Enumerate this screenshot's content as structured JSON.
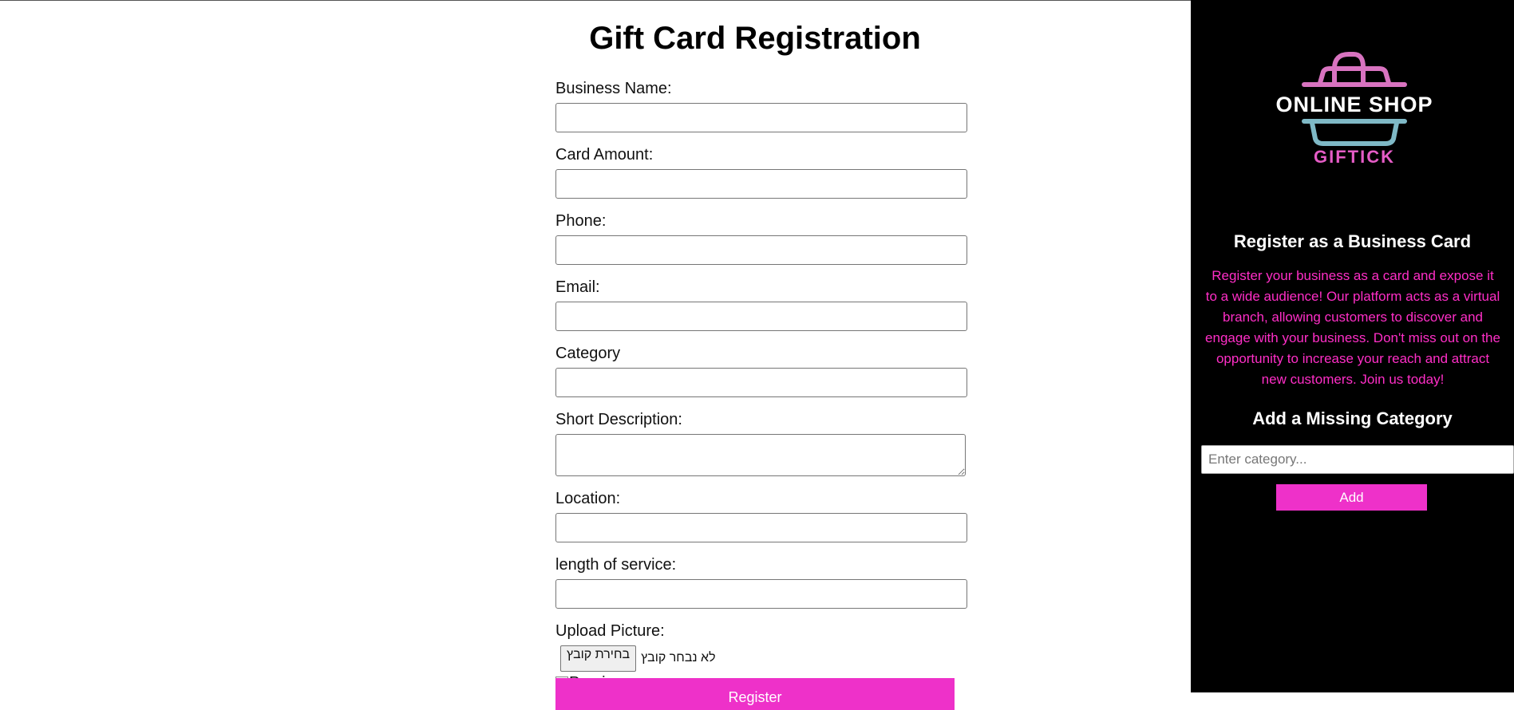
{
  "page": {
    "title": "Gift Card Registration"
  },
  "form": {
    "fields": [
      {
        "label": "Business Name:",
        "value": ""
      },
      {
        "label": "Card Amount:",
        "value": ""
      },
      {
        "label": "Phone:",
        "value": ""
      },
      {
        "label": "Email:",
        "value": ""
      },
      {
        "label": "Category",
        "value": ""
      },
      {
        "label": "Short Description:",
        "value": ""
      },
      {
        "label": "Location:",
        "value": ""
      },
      {
        "label": "length of service:",
        "value": ""
      }
    ],
    "upload": {
      "label": "Upload Picture:",
      "button_label": "בחירת קובץ",
      "status": "לא נבחר קובץ",
      "preview_alt": "Preview"
    },
    "submit_label": "Register"
  },
  "sidebar": {
    "logo": {
      "text": "ONLINE SHOP",
      "subtext": "GIFTICK",
      "colors": {
        "bag_handle": "#d873c0",
        "bag_base": "#7fb9c6"
      }
    },
    "register": {
      "heading": "Register as a Business Card",
      "text": "Register your business as a card and expose it to a wide audience! Our platform acts as a virtual branch, allowing customers to discover and engage with your business. Don't miss out on the opportunity to increase your reach and attract new customers. Join us today!"
    },
    "category": {
      "heading": "Add a Missing Category",
      "placeholder": "Enter category...",
      "button_label": "Add"
    }
  },
  "colors": {
    "accent": "#ee31c9",
    "sidebar_bg": "#000000",
    "sidebar_text": "#ff2ec7"
  }
}
